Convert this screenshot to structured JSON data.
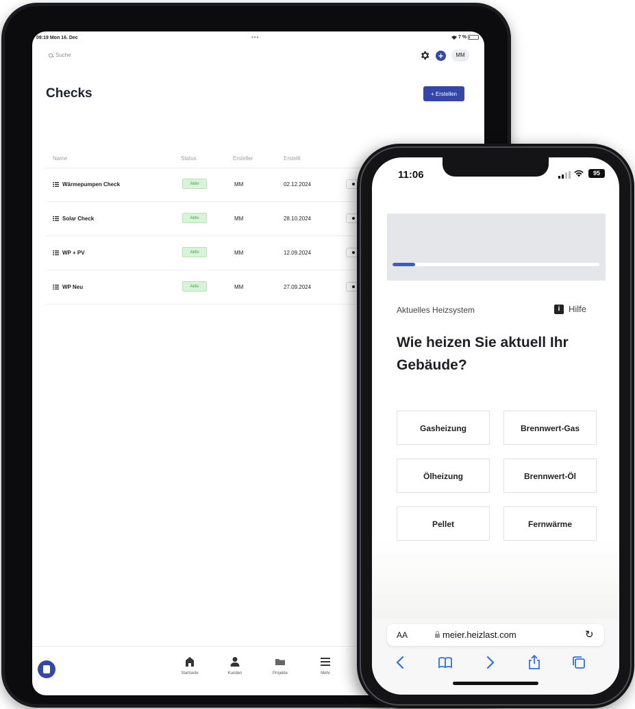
{
  "tablet": {
    "status": {
      "time": "09:19  Mon 16. Dec",
      "dots": "•••",
      "battery": "7 %"
    },
    "search": {
      "placeholder": "Suche"
    },
    "user_initials": "MM",
    "page_title": "Checks",
    "create_button": "+ Erstellen",
    "table": {
      "headers": [
        "Name",
        "Status",
        "Ersteller",
        "Erstellt"
      ],
      "rows": [
        {
          "name": "Wärmepumpen Check",
          "status": "Aktiv",
          "creator": "MM",
          "created": "02.12.2024"
        },
        {
          "name": "Solar Check",
          "status": "Aktiv",
          "creator": "MM",
          "created": "28.10.2024"
        },
        {
          "name": "WP + PV",
          "status": "Aktiv",
          "creator": "MM",
          "created": "12.09.2024"
        },
        {
          "name": "WP Neu",
          "status": "Aktiv",
          "creator": "MM",
          "created": "27.09.2024"
        }
      ]
    },
    "bottom_nav": [
      {
        "label": "Startseite",
        "icon": "home-icon"
      },
      {
        "label": "Kunden",
        "icon": "user-icon"
      },
      {
        "label": "Projekte",
        "icon": "folder-icon"
      },
      {
        "label": "Mehr",
        "icon": "menu-icon"
      }
    ],
    "colors": {
      "accent": "#3446a8",
      "status_green": "#3fa14c"
    }
  },
  "phone": {
    "status": {
      "time": "11:06",
      "battery": "95"
    },
    "progress": 0.11,
    "section_label": "Aktuelles Heizsystem",
    "help_label": "Hilfe",
    "question": "Wie heizen Sie aktuell Ihr Gebäude?",
    "options": [
      "Gasheizung",
      "Brennwert-Gas",
      "Ölheizung",
      "Brennwert-Öl",
      "Pellet",
      "Fernwärme"
    ],
    "browser": {
      "text_size": "AA",
      "url": "meier.heizlast.com"
    },
    "colors": {
      "progress": "#3a5cc7"
    }
  }
}
